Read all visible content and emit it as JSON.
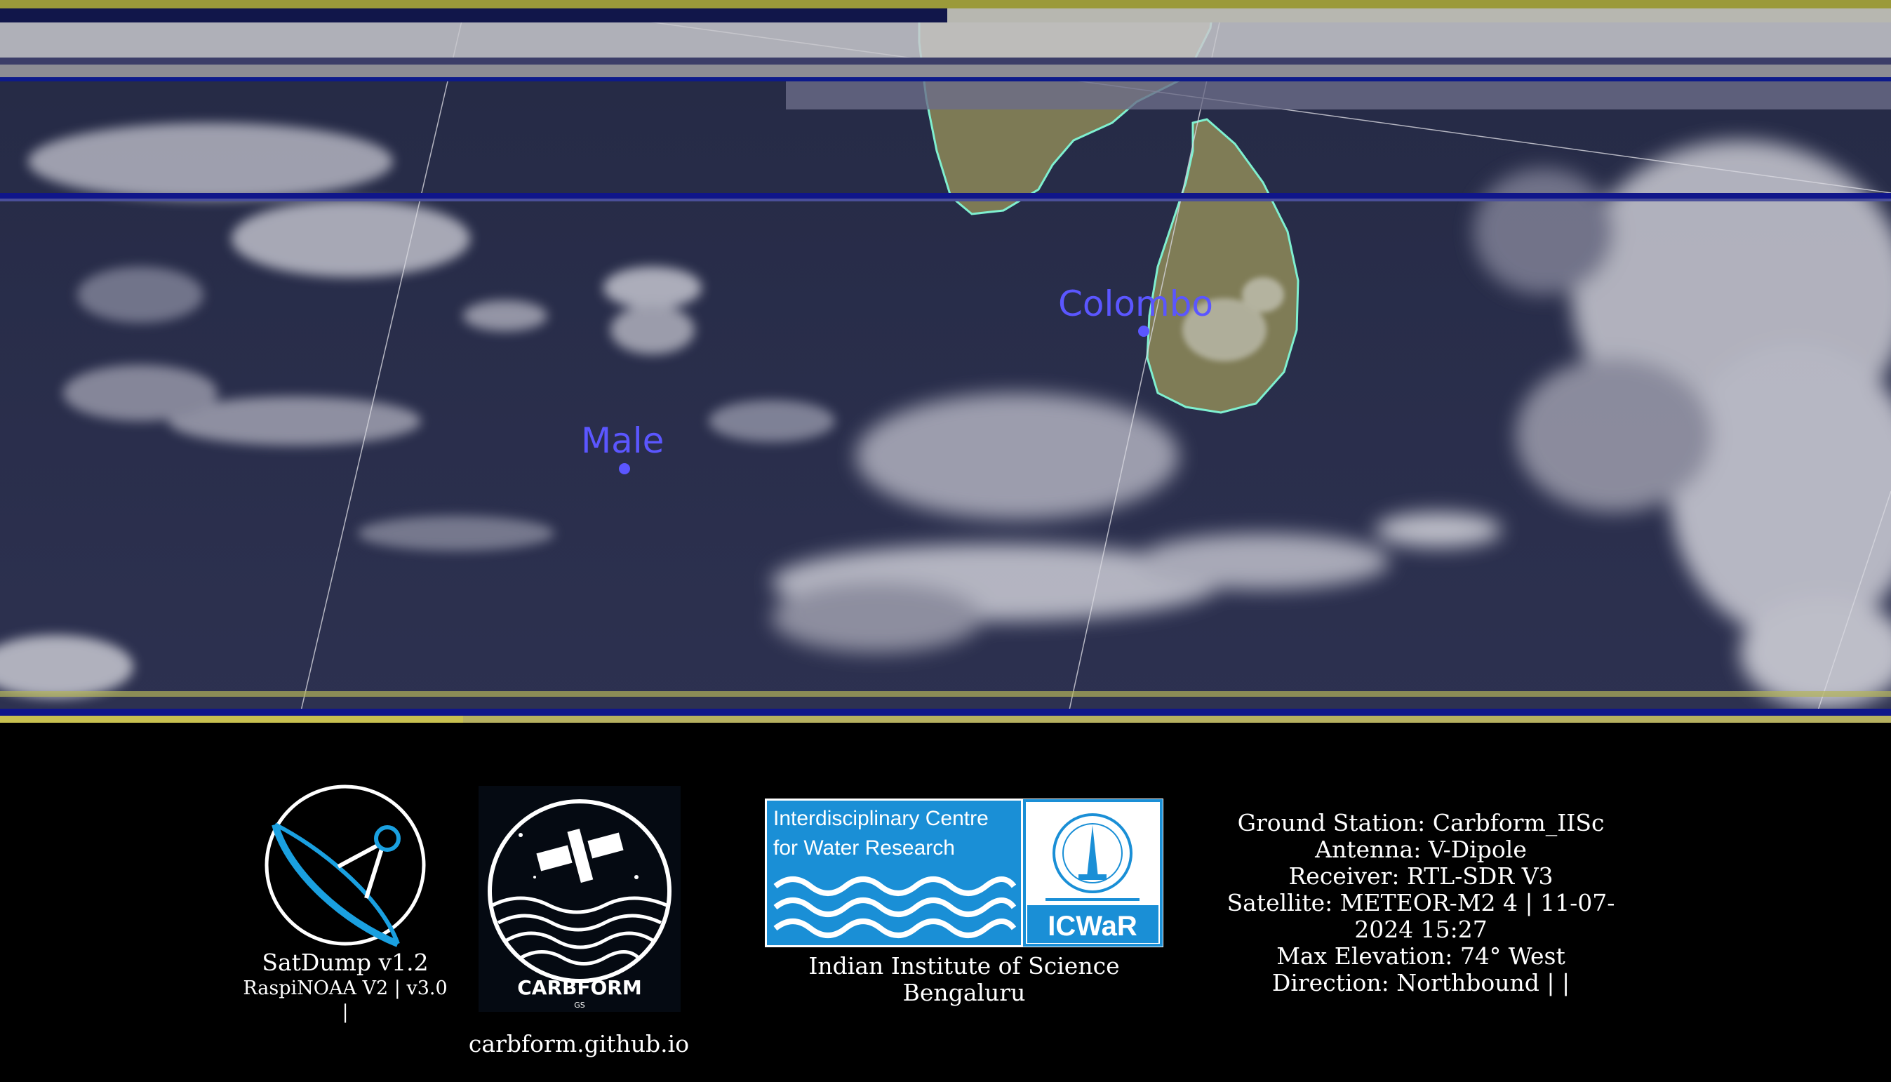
{
  "map": {
    "cities": [
      {
        "name": "Colombo"
      },
      {
        "name": "Male"
      }
    ],
    "colors": {
      "ocean": "#2a2e48",
      "land": "#7d7a55",
      "coast": "#7ff0d0",
      "label": "#5b56ff"
    }
  },
  "satdump": {
    "title": "SatDump v1.2",
    "subtitle": "RaspiNOAA V2 | v3.0 |"
  },
  "carbform": {
    "logo_text": "CARBFORM",
    "logo_sub": "GS",
    "url": "carbform.github.io"
  },
  "icwar": {
    "line1": "Interdisciplinary Centre",
    "line2": "for Water Research",
    "badge": "ICWaR",
    "colors": {
      "blue": "#1a8fd6"
    }
  },
  "institute": {
    "name": "Indian Institute of Science",
    "city": "Bengaluru"
  },
  "station": {
    "ground_station": "Ground Station: Carbform_IISc",
    "antenna": "Antenna: V-Dipole",
    "receiver": "Receiver: RTL-SDR V3",
    "satellite": "Satellite: METEOR-M2 4 | 11-07-2024 15:27",
    "max_elevation": "Max Elevation: 74° West",
    "direction": "Direction: Northbound | |"
  }
}
